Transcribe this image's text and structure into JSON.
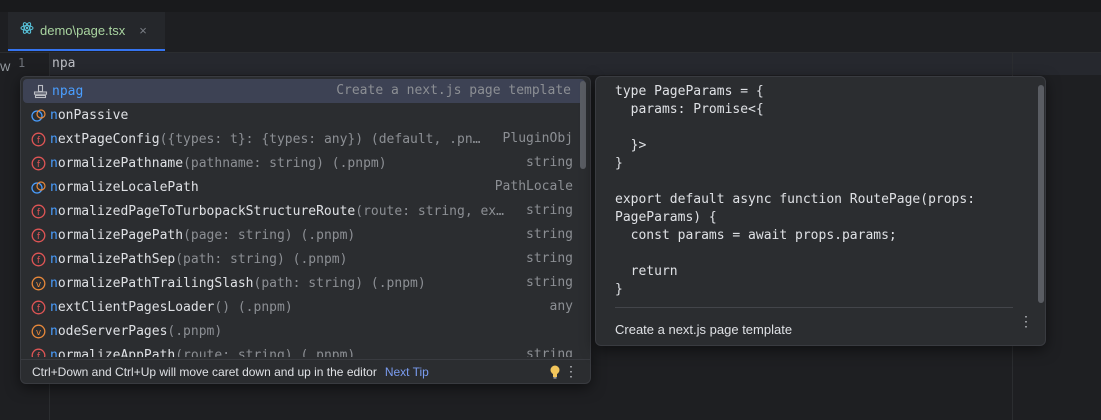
{
  "editor": {
    "tab_label": "demo\\page.tsx",
    "close_glyph": "×",
    "line_number": "1",
    "typed_text": "npa",
    "left_edge_text": "W"
  },
  "completion": {
    "items": [
      {
        "icon": "template-icon",
        "match": "npag",
        "rest": "",
        "sig": "",
        "type": "Create a next.js page template",
        "selected": true
      },
      {
        "icon": "variable-icon",
        "match": "n",
        "rest": "onPassive",
        "sig": "",
        "type": ""
      },
      {
        "icon": "function-icon",
        "match": "n",
        "rest": "extPageConfig",
        "sig": "({types: t}: {types: any}) (default, .pn…",
        "type": "PluginObj"
      },
      {
        "icon": "function-icon",
        "match": "n",
        "rest": "ormalizePathname",
        "sig": "(pathname: string) (.pnpm)",
        "type": "string"
      },
      {
        "icon": "variable-icon",
        "match": "n",
        "rest": "ormalizeLocalePath",
        "sig": "",
        "type": "PathLocale"
      },
      {
        "icon": "function-icon",
        "match": "n",
        "rest": "ormalizedPageToTurbopackStructureRoute",
        "sig": "(route: string, ex…",
        "type": "string"
      },
      {
        "icon": "function-icon",
        "match": "n",
        "rest": "ormalizePagePath",
        "sig": "(page: string) (.pnpm)",
        "type": "string"
      },
      {
        "icon": "function-icon",
        "match": "n",
        "rest": "ormalizePathSep",
        "sig": "(path: string) (.pnpm)",
        "type": "string"
      },
      {
        "icon": "var-v-icon",
        "match": "n",
        "rest": "ormalizePathTrailingSlash",
        "sig": "(path: string) (.pnpm)",
        "type": "string"
      },
      {
        "icon": "function-icon",
        "match": "n",
        "rest": "extClientPagesLoader",
        "sig": "() (.pnpm)",
        "type": "any"
      },
      {
        "icon": "var-v-icon",
        "match": "n",
        "rest": "odeServerPages",
        "sig": " (.pnpm)",
        "type": ""
      },
      {
        "icon": "function-icon",
        "match": "n",
        "rest": "ormalizeAppPath",
        "sig": "(route: string) (.pnpm)",
        "type": "string"
      }
    ],
    "footer_tip": "Ctrl+Down and Ctrl+Up will move caret down and up in the editor",
    "next_tip": "Next Tip",
    "more_glyph": "⋮"
  },
  "doc_popup": {
    "code": "type PageParams = {\n  params: Promise<{\n    \n  }>\n}\n\nexport default async function RoutePage(props:\nPageParams) {\n  const params = await props.params;\n\n  return\n}",
    "description": "Create a next.js page template",
    "more_glyph": "⋮"
  },
  "colors": {
    "accent": "#3574f0",
    "match_highlight": "#4a9eff",
    "function_icon": "#e05555",
    "variable_icon": "#e8883a"
  }
}
